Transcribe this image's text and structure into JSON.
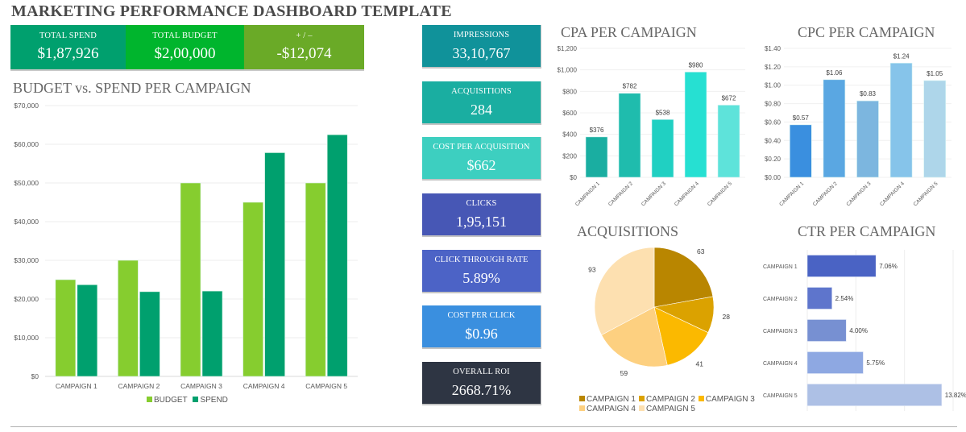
{
  "page": {
    "title": "MARKETING PERFORMANCE DASHBOARD TEMPLATE"
  },
  "top_kpis": [
    {
      "label": "TOTAL SPEND",
      "value": "$1,87,926",
      "color": "#00a06e"
    },
    {
      "label": "TOTAL BUDGET",
      "value": "$2,00,000",
      "color": "#00b52d"
    },
    {
      "label": "+ / –",
      "value": "-$12,074",
      "color": "#6aaa27"
    }
  ],
  "kpi_tiles": [
    {
      "label": "IMPRESSIONS",
      "value": "33,10,767",
      "color": "#10929a"
    },
    {
      "label": "ACQUISITIONS",
      "value": "284",
      "color": "#1aaea1"
    },
    {
      "label": "COST PER ACQUISITION",
      "value": "$662",
      "color": "#3dcfc0"
    },
    {
      "label": "CLICKS",
      "value": "1,95,151",
      "color": "#4757b5"
    },
    {
      "label": "CLICK THROUGH RATE",
      "value": "5.89%",
      "color": "#4c63c6"
    },
    {
      "label": "COST PER CLICK",
      "value": "$0.96",
      "color": "#3a8fdf"
    },
    {
      "label": "OVERALL ROI",
      "value": "2668.71%",
      "color": "#2e3543"
    }
  ],
  "chart_data": [
    {
      "id": "budget_vs_spend",
      "type": "bar",
      "title": "BUDGET vs. SPEND PER CAMPAIGN",
      "categories": [
        "CAMPAIGN 1",
        "CAMPAIGN 2",
        "CAMPAIGN 3",
        "CAMPAIGN 4",
        "CAMPAIGN 5"
      ],
      "series": [
        {
          "name": "BUDGET",
          "values": [
            25000,
            30000,
            50000,
            45000,
            50000
          ],
          "color": "#86cd2f"
        },
        {
          "name": "SPEND",
          "values": [
            23688,
            21896,
            22058,
            57820,
            62464
          ],
          "color": "#00a06e"
        }
      ],
      "yticks": [
        "$0",
        "$10,000",
        "$20,000",
        "$30,000",
        "$40,000",
        "$50,000",
        "$60,000",
        "$70,000"
      ],
      "ylim": [
        0,
        70000
      ],
      "xlabel": "",
      "ylabel": "",
      "grid": true,
      "legend": "bottom"
    },
    {
      "id": "cpa",
      "type": "bar",
      "title": "CPA PER CAMPAIGN",
      "categories": [
        "CAMPAIGN 1",
        "CAMPAIGN 2",
        "CAMPAIGN 3",
        "CAMPAIGN 4",
        "CAMPAIGN 5"
      ],
      "values": [
        376,
        782,
        538,
        980,
        672
      ],
      "labels": [
        "$376",
        "$782",
        "$538",
        "$980",
        "$672"
      ],
      "colors": [
        "#1aaea1",
        "#1fbcad",
        "#20d0c2",
        "#26e0d2",
        "#5ee3da"
      ],
      "yticks": [
        "$0",
        "$200",
        "$400",
        "$600",
        "$800",
        "$1,000",
        "$1,200"
      ],
      "ylim": [
        0,
        1200
      ],
      "grid": true
    },
    {
      "id": "cpc",
      "type": "bar",
      "title": "CPC PER CAMPAIGN",
      "categories": [
        "CAMPAIGN 1",
        "CAMPAIGN 2",
        "CAMPAIGN 3",
        "CAMPAIGN 4",
        "CAMPAIGN 5"
      ],
      "values": [
        0.57,
        1.06,
        0.83,
        1.24,
        1.05
      ],
      "labels": [
        "$0.57",
        "$1.06",
        "$0.83",
        "$1.24",
        "$1.05"
      ],
      "colors": [
        "#3a8fdf",
        "#5aa7e2",
        "#7cb6df",
        "#86c4ea",
        "#aed6ea"
      ],
      "yticks": [
        "$0.00",
        "$0.20",
        "$0.40",
        "$0.60",
        "$0.80",
        "$1.00",
        "$1.20",
        "$1.40"
      ],
      "ylim": [
        0,
        1.4
      ],
      "grid": true
    },
    {
      "id": "acquisitions",
      "type": "pie",
      "title": "ACQUISITIONS",
      "categories": [
        "CAMPAIGN 1",
        "CAMPAIGN 2",
        "CAMPAIGN 3",
        "CAMPAIGN 4",
        "CAMPAIGN 5"
      ],
      "values": [
        63,
        28,
        41,
        59,
        93
      ],
      "colors": [
        "#b98600",
        "#dba200",
        "#fbb900",
        "#fdd080",
        "#fde0b0"
      ],
      "legend": "bottom"
    },
    {
      "id": "ctr",
      "type": "bar",
      "orientation": "horizontal",
      "title": "CTR PER CAMPAIGN",
      "categories": [
        "CAMPAIGN 1",
        "CAMPAIGN 2",
        "CAMPAIGN 3",
        "CAMPAIGN 4",
        "CAMPAIGN 5"
      ],
      "values": [
        7.06,
        2.54,
        4.0,
        5.75,
        13.82
      ],
      "labels": [
        "7.06%",
        "2.54%",
        "4.00%",
        "5.75%",
        "13.82%"
      ],
      "colors": [
        "#4a63c4",
        "#5e75cc",
        "#7790d2",
        "#8ea8e2",
        "#adc0e5"
      ],
      "xlim": [
        0,
        15
      ],
      "grid": true
    }
  ]
}
